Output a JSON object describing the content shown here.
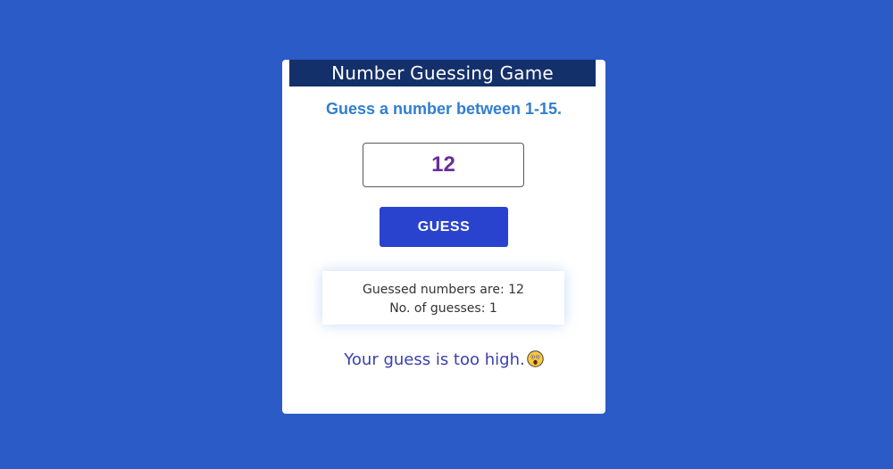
{
  "game": {
    "title": "Number Guessing Game",
    "instruction": "Guess a number between 1-15.",
    "input_value": "12",
    "guess_button_label": "GUESS",
    "guessed_numbers_text": "Guessed numbers are: 12",
    "guess_count_text": "No. of guesses: 1",
    "result_message": "Your guess is too high.",
    "result_icon": "astonished-face-emoji-icon"
  },
  "colors": {
    "background": "#2a5bc7",
    "title_bar": "#14306a",
    "instruction_text": "#2f7fd0",
    "input_text": "#6a2c9c",
    "button": "#2a43cf",
    "result_text": "#3b3fb0"
  }
}
